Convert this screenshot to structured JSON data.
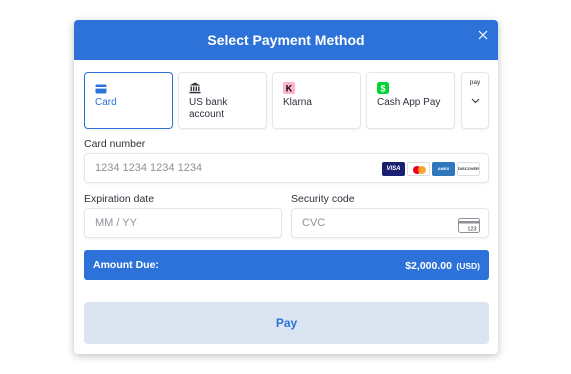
{
  "dialog": {
    "title": "Select Payment Method",
    "accent_color": "#2d72d9",
    "close_icon": "close-icon"
  },
  "methods": [
    {
      "label": "Card",
      "icon": "card-icon",
      "selected": true
    },
    {
      "label": "US bank account",
      "icon": "bank-icon",
      "selected": false
    },
    {
      "label": "Klarna",
      "icon": "klarna-icon",
      "selected": false
    },
    {
      "label": "Cash App Pay",
      "icon": "cashapp-icon",
      "selected": false
    },
    {
      "label": "pay",
      "icon": "amazon-pay-icon",
      "selected": false
    }
  ],
  "card_number": {
    "label": "Card number",
    "placeholder": "1234 1234 1234 1234",
    "brands": [
      "VISA",
      "Mastercard",
      "AMEX",
      "DISCOVER"
    ]
  },
  "expiration": {
    "label": "Expiration date",
    "placeholder": "MM / YY"
  },
  "security_code": {
    "label": "Security code",
    "placeholder": "CVC",
    "icon_text": "123"
  },
  "amount": {
    "label": "Amount Due:",
    "value": "$2,000.00",
    "currency": "(USD)"
  },
  "pay_button": {
    "label": "Pay"
  }
}
